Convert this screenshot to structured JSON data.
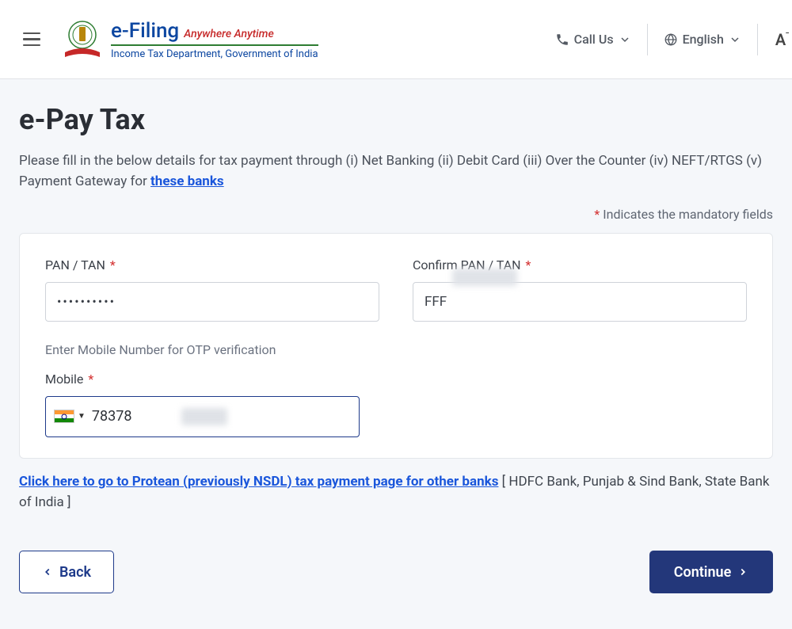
{
  "header": {
    "brand_name": "e-Filing",
    "brand_tagline": "Anywhere Anytime",
    "brand_subtitle": "Income Tax Department, Government of India",
    "call_label": "Call Us",
    "lang_label": "English",
    "partial_right": "A"
  },
  "page": {
    "title": "e-Pay Tax",
    "subtitle_prefix": "Please fill in the below details for tax payment through (i) Net Banking (ii) Debit Card (iii) Over the Counter (iv) NEFT/RTGS (v) Payment Gateway for ",
    "subtitle_link": "these banks",
    "mandatory_note": "Indicates the mandatory fields",
    "mandatory_star": "*"
  },
  "form": {
    "pan_label": "PAN / TAN",
    "pan_value": "••••••••••",
    "confirm_label": "Confirm PAN / TAN",
    "confirm_value": "FFF",
    "otp_hint": "Enter Mobile Number for OTP verification",
    "mobile_label": "Mobile",
    "mobile_value": "78378",
    "required_marker": "*"
  },
  "below": {
    "link_text": "Click here to go to Protean (previously NSDL) tax payment page for other banks",
    "suffix": " [ HDFC Bank, Punjab & Sind Bank, State Bank of India ]"
  },
  "actions": {
    "back": "Back",
    "continue": "Continue"
  }
}
